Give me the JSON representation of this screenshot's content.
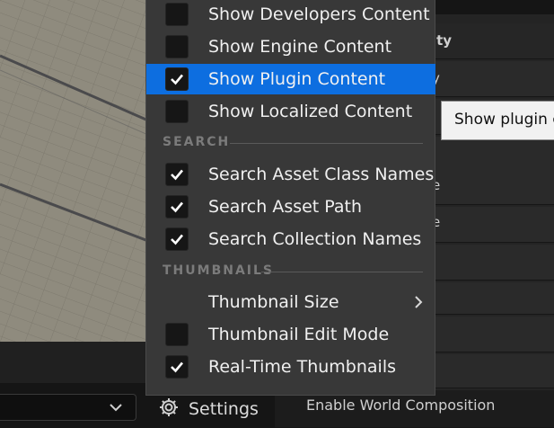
{
  "menu": {
    "items_top": [
      {
        "label": "Show Developers Content",
        "checked": false
      },
      {
        "label": "Show Engine Content",
        "checked": false
      },
      {
        "label": "Show Plugin Content",
        "checked": true,
        "highlighted": true
      },
      {
        "label": "Show Localized Content",
        "checked": false
      }
    ],
    "search_header": "SEARCH",
    "search_items": [
      {
        "label": "Search Asset Class Names",
        "checked": true
      },
      {
        "label": "Search Asset Path",
        "checked": true
      },
      {
        "label": "Search Collection Names",
        "checked": true
      }
    ],
    "thumbnails_header": "THUMBNAILS",
    "thumbnail_size_label": "Thumbnail Size",
    "thumbnail_items": [
      {
        "label": "Thumbnail Edit Mode",
        "checked": false
      },
      {
        "label": "Real-Time Thumbnails",
        "checked": true
      }
    ]
  },
  "tooltip": {
    "text": "Show plugin c"
  },
  "settings_button": {
    "label": "Settings",
    "icon": "gear-icon"
  },
  "details_panel": {
    "visible_fragments": [
      "ity",
      "y",
      "e",
      "e"
    ],
    "footer_label": "Enable World Composition"
  },
  "colors": {
    "highlight": "#0d6ee0",
    "menu_bg": "#383838",
    "tooltip_bg": "#f1f1f1"
  }
}
